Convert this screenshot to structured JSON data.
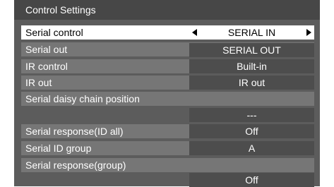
{
  "window": {
    "title": "Control Settings"
  },
  "settings": [
    {
      "label": "Serial control",
      "value": "SERIAL IN"
    },
    {
      "label": "Serial out",
      "value": "SERIAL OUT"
    },
    {
      "label": "IR control",
      "value": "Built-in"
    },
    {
      "label": "IR out",
      "value": "IR out"
    },
    {
      "label": "Serial daisy chain position",
      "value": "---"
    },
    {
      "label": "Serial response(ID all)",
      "value": "Off"
    },
    {
      "label": "Serial ID group",
      "value": "A"
    },
    {
      "label": "Serial response(group)",
      "value": "Off"
    }
  ],
  "icons": {
    "left": "arrow-left-icon",
    "right": "arrow-right-icon"
  }
}
